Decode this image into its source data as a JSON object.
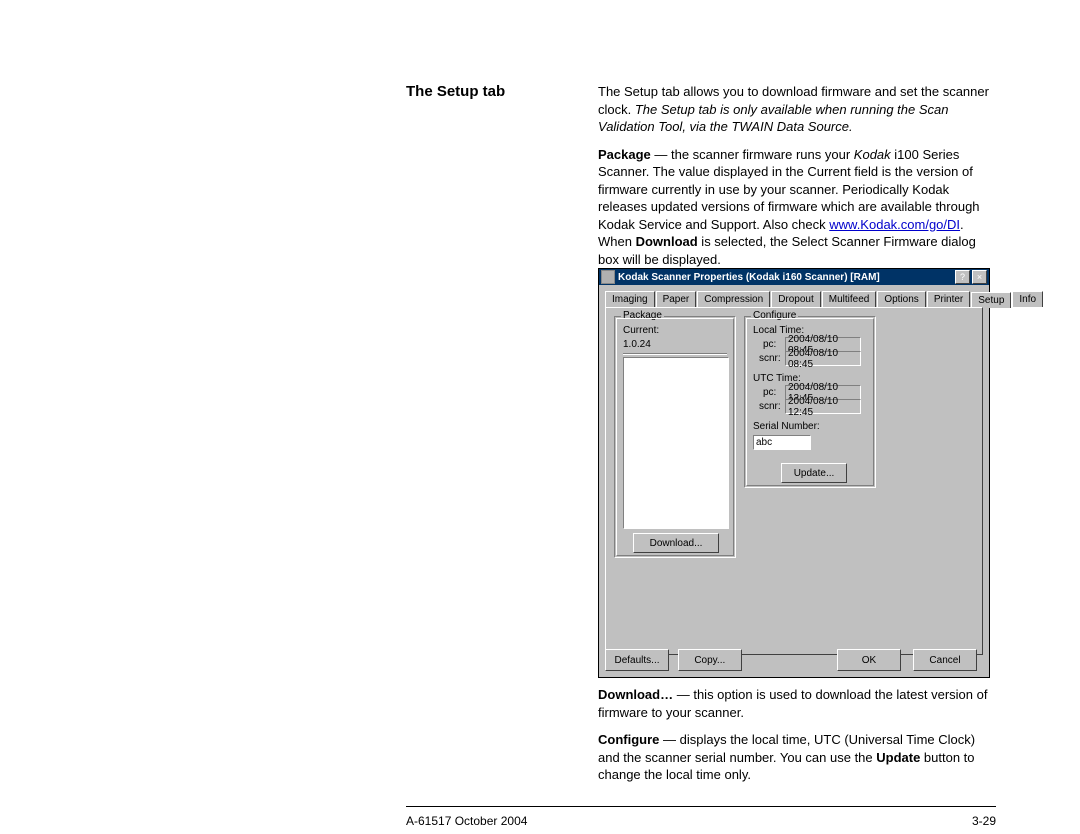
{
  "heading": "The Setup tab",
  "para1": {
    "pre": "The Setup tab allows you to download firmware and set the scanner clock. ",
    "italic": "The Setup tab is only available when running the Scan Validation Tool, via the TWAIN Data Source."
  },
  "para2": {
    "bold1": "Package",
    "mid1": " — the scanner firmware runs your ",
    "italic1": "Kodak",
    "mid2": " i100 Series Scanner. The value displayed in the Current field is the version of firmware currently in use by your scanner. Periodically Kodak releases updated versions of firmware which are available through Kodak Service and Support. Also check ",
    "link": "www.Kodak.com/go/DI",
    "mid3": ". When ",
    "bold2": "Download",
    "mid4": " is selected, the Select Scanner Firmware dialog box will be displayed."
  },
  "dialog": {
    "title": "Kodak Scanner Properties (Kodak i160 Scanner) [RAM]",
    "help_glyph": "?",
    "close_glyph": "×",
    "tabs": [
      "Imaging",
      "Paper",
      "Compression",
      "Dropout",
      "Multifeed",
      "Options",
      "Printer",
      "Setup",
      "Info"
    ],
    "active_tab": "Setup",
    "package": {
      "legend": "Package",
      "current_label": "Current:",
      "current_value": "1.0.24",
      "download_btn": "Download..."
    },
    "configure": {
      "legend": "Configure",
      "local_time_label": "Local Time:",
      "pc_label": "pc:",
      "scnr_label": "scnr:",
      "pc_local": "2004/08/10 08:45",
      "scnr_local": "2004/08/10 08:45",
      "utc_time_label": "UTC Time:",
      "pc_utc": "2004/08/10 12:45",
      "scnr_utc": "2004/08/10 12:45",
      "serial_label": "Serial Number:",
      "serial_value": "abc",
      "update_btn": "Update..."
    },
    "buttons": {
      "defaults": "Defaults...",
      "copy": "Copy...",
      "ok": "OK",
      "cancel": "Cancel"
    }
  },
  "para3": {
    "bold": "Download…",
    "rest": " — this option is used to download the latest version of firmware to your scanner."
  },
  "para4": {
    "bold1": "Configure",
    "mid1": " — displays the local time, UTC (Universal Time Clock) and the scanner serial number. You can use the ",
    "bold2": "Update",
    "mid2": " button to change the local time only."
  },
  "footer": {
    "left": "A-61517  October 2004",
    "right": "3-29"
  }
}
